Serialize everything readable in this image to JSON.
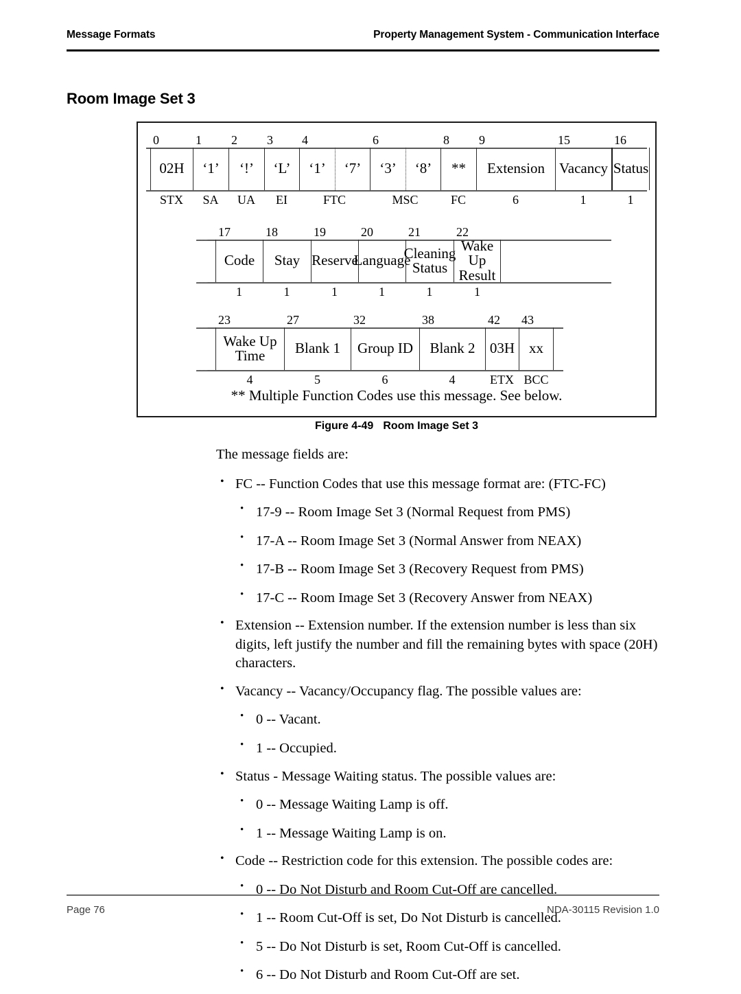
{
  "header": {
    "left": "Message Formats",
    "right": "Property Management System - Communication Interface"
  },
  "section_title": "Room Image Set 3",
  "figure": {
    "note": "** Multiple Function Codes use this message. See below.",
    "caption_number": "Figure 4-49",
    "caption_text": "Room Image Set 3",
    "rows": [
      {
        "offsets": [
          "0",
          "1",
          "2",
          "3",
          "4",
          "6",
          "8",
          "9",
          "15",
          "16"
        ],
        "cells": [
          {
            "value": "02H",
            "width_label": "STX"
          },
          {
            "value": "‘1’",
            "width_label": "SA"
          },
          {
            "value": "‘!’",
            "width_label": "UA"
          },
          {
            "value": "‘L’",
            "width_label": "EI"
          },
          {
            "value": "‘1’",
            "width_label": "FTC"
          },
          {
            "value": "‘7’",
            "width_label": ""
          },
          {
            "value": "‘3’",
            "width_label": "MSC"
          },
          {
            "value": "‘8’",
            "width_label": ""
          },
          {
            "value": "**",
            "width_label": "FC"
          },
          {
            "value": "Extension",
            "width_label": "6"
          },
          {
            "value": "Vacancy",
            "width_label": "1"
          },
          {
            "value": "Status",
            "width_label": "1"
          }
        ]
      },
      {
        "offsets": [
          "17",
          "18",
          "19",
          "20",
          "21",
          "22"
        ],
        "cells": [
          {
            "value": "Code",
            "width_label": "1"
          },
          {
            "value": "Stay",
            "width_label": "1"
          },
          {
            "value": "Reserve",
            "width_label": "1"
          },
          {
            "value": "Language",
            "width_label": "1"
          },
          {
            "line1": "Cleaning",
            "line2": "Status",
            "width_label": "1"
          },
          {
            "line1": "Wake Up",
            "line2": "Result",
            "width_label": "1"
          }
        ]
      },
      {
        "offsets": [
          "23",
          "27",
          "32",
          "38",
          "42",
          "43"
        ],
        "cells": [
          {
            "line1": "Wake Up",
            "line2": "Time",
            "width_label": "4"
          },
          {
            "value": "Blank 1",
            "width_label": "5"
          },
          {
            "value": "Group ID",
            "width_label": "6"
          },
          {
            "value": "Blank 2",
            "width_label": "4"
          },
          {
            "value": "03H",
            "width_label": "ETX"
          },
          {
            "value": "xx",
            "width_label": "BCC"
          }
        ]
      }
    ]
  },
  "body": {
    "lead": "The message fields are:",
    "bullet_glyph": "•",
    "items": [
      {
        "text": "FC -- Function Codes that use this message format are: (FTC-FC)",
        "sub": [
          "17-9 -- Room Image Set 3 (Normal Request from PMS)",
          "17-A -- Room Image Set 3 (Normal Answer from NEAX)",
          "17-B -- Room Image Set 3 (Recovery Request from PMS)",
          "17-C -- Room Image Set 3 (Recovery Answer from NEAX)"
        ]
      },
      {
        "text": "Extension -- Extension number. If the extension number is less than six digits, left justify the number and fill the remaining bytes with space (20H) characters.",
        "sub": []
      },
      {
        "text": "Vacancy -- Vacancy/Occupancy flag. The possible values are:",
        "sub": [
          "0 -- Vacant.",
          "1 -- Occupied."
        ]
      },
      {
        "text": "Status - Message Waiting status. The possible values are:",
        "sub": [
          "0 -- Message Waiting Lamp is off.",
          "1 -- Message Waiting Lamp is on."
        ]
      },
      {
        "text": "Code -- Restriction code for this extension. The possible codes are:",
        "sub": [
          "0 -- Do Not Disturb and Room Cut-Off are cancelled.",
          "1 -- Room Cut-Off is set, Do Not Disturb is cancelled.",
          "5 -- Do Not Disturb is set, Room Cut-Off is cancelled.",
          "6 -- Do Not Disturb and Room Cut-Off are set."
        ]
      }
    ]
  },
  "footer": {
    "left": "Page 76",
    "right": "NDA-30115  Revision 1.0"
  },
  "colors": {
    "ink": "#000000",
    "rule": "#2b2b2b",
    "frame": "#1a1a1a",
    "muted": "#5a5a5a"
  }
}
